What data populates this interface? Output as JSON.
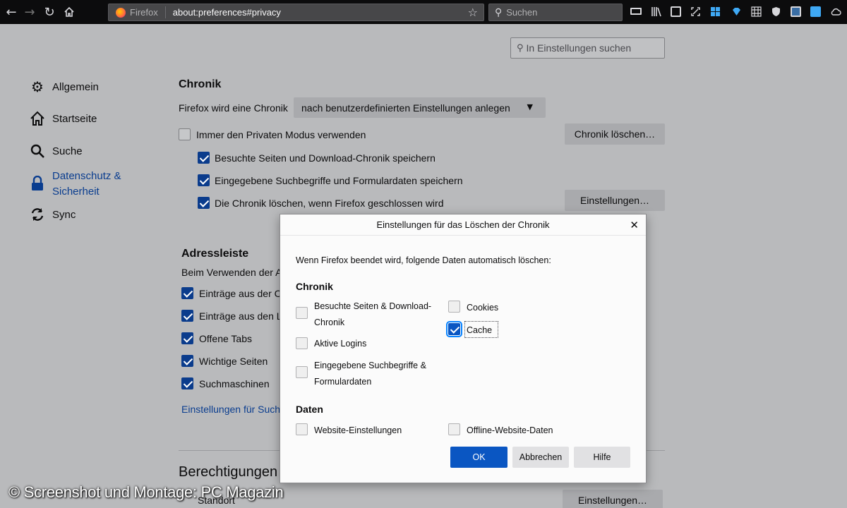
{
  "browser": {
    "identity_label": "Firefox",
    "url": "about:preferences#privacy",
    "search_placeholder": "Suchen"
  },
  "prefs": {
    "search_placeholder": "In Einstellungen suchen",
    "nav": [
      {
        "label": "Allgemein",
        "icon": "gear-icon"
      },
      {
        "label": "Startseite",
        "icon": "home-icon"
      },
      {
        "label": "Suche",
        "icon": "search-icon"
      },
      {
        "label": "Datenschutz & Sicherheit",
        "icon": "lock-icon",
        "active": true
      },
      {
        "label": "Sync",
        "icon": "sync-icon"
      }
    ],
    "chronik": {
      "heading": "Chronik",
      "mode_label": "Firefox wird eine Chronik",
      "mode_value": "nach benutzerdefinierten Einstellungen anlegen",
      "private_mode": {
        "label": "Immer den Privaten Modus verwenden",
        "checked": false
      },
      "clear_button": "Chronik löschen…",
      "options": [
        {
          "label": "Besuchte Seiten und Download-Chronik speichern",
          "checked": true
        },
        {
          "label": "Eingegebene Suchbegriffe und Formulardaten speichern",
          "checked": true
        },
        {
          "label": "Die Chronik löschen, wenn Firefox geschlossen wird",
          "checked": true
        }
      ],
      "settings_button": "Einstellungen…"
    },
    "adressleiste": {
      "heading": "Adressleiste",
      "intro": "Beim Verwenden der A",
      "options": [
        {
          "label": "Einträge aus der C",
          "checked": true
        },
        {
          "label": "Einträge aus den L",
          "checked": true
        },
        {
          "label": "Offene Tabs",
          "checked": true
        },
        {
          "label": "Wichtige Seiten",
          "checked": true
        },
        {
          "label": "Suchmaschinen",
          "checked": true
        }
      ],
      "link": "Einstellungen für Such"
    },
    "berechtigungen": {
      "heading": "Berechtigungen",
      "item": "Standort",
      "settings_button": "Einstellungen…"
    }
  },
  "dialog": {
    "title": "Einstellungen für das Löschen der Chronik",
    "intro": "Wenn Firefox beendet wird, folgende Daten automatisch löschen:",
    "chronik_heading": "Chronik",
    "chronik_left": [
      {
        "line1": "Besuchte Seiten & Download-",
        "line2": "Chronik",
        "checked": false
      },
      {
        "line1": "Aktive Logins",
        "line2": "",
        "checked": false
      },
      {
        "line1": "Eingegebene Suchbegriffe &",
        "line2": "Formulardaten",
        "checked": false
      }
    ],
    "chronik_right": [
      {
        "label": "Cookies",
        "checked": false
      },
      {
        "label": "Cache",
        "checked": true
      }
    ],
    "daten_heading": "Daten",
    "daten": [
      {
        "label": "Website-Einstellungen",
        "checked": false
      },
      {
        "label": "Offline-Website-Daten",
        "checked": false
      }
    ],
    "buttons": {
      "ok": "OK",
      "cancel": "Abbrechen",
      "help": "Hilfe"
    }
  },
  "watermark": "© Screenshot und Montage: PC Magazin"
}
